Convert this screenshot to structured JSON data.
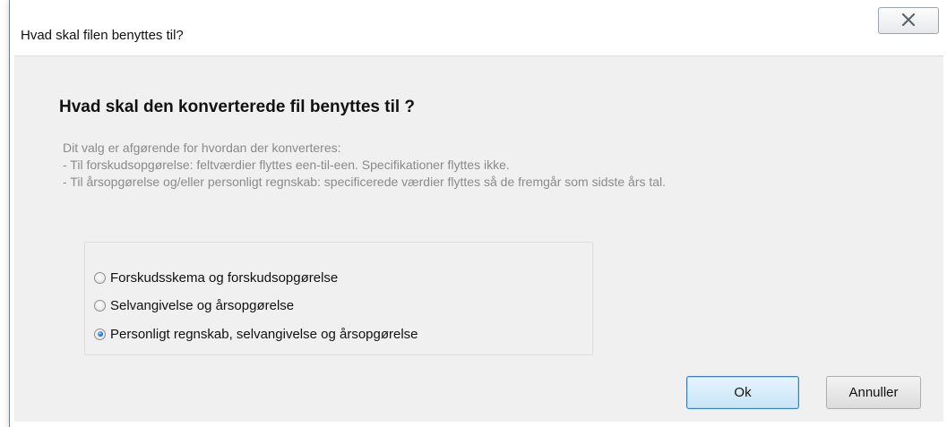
{
  "window": {
    "title": "Hvad skal filen benyttes til?",
    "close_icon": "close-icon"
  },
  "content": {
    "heading": "Hvad skal den konverterede fil  benyttes til ?",
    "description": [
      "Dit valg er afgørende for hvordan der konverteres:",
      "- Til forskudsopgørelse: feltværdier flyttes een-til-een. Specifikationer flyttes ikke.",
      "- Til årsopgørelse og/eller personligt regnskab: specificerede værdier flyttes så de fremgår som sidste års tal."
    ],
    "options": [
      {
        "label": "Forskudsskema og forskudsopgørelse",
        "checked": false
      },
      {
        "label": "Selvangivelse og årsopgørelse",
        "checked": false
      },
      {
        "label": "Personligt regnskab, selvangivelse og årsopgørelse",
        "checked": true
      }
    ]
  },
  "buttons": {
    "ok_label": "Ok",
    "cancel_label": "Annuller"
  }
}
